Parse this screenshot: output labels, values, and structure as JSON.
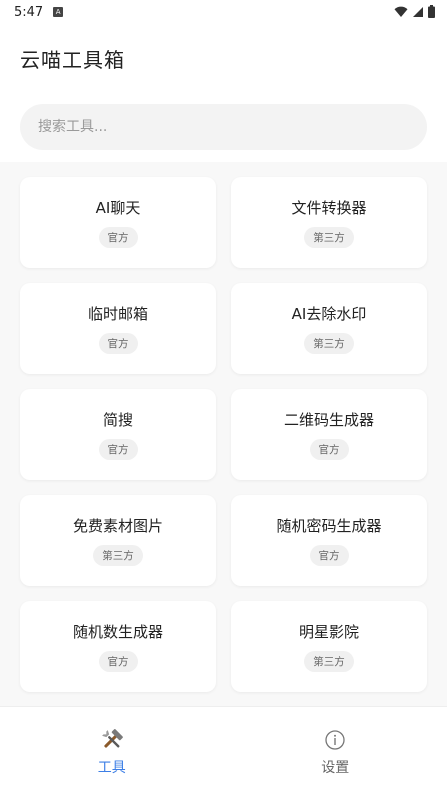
{
  "status_bar": {
    "time": "5:47",
    "notification_badge": "A"
  },
  "app": {
    "title": "云喵工具箱"
  },
  "search": {
    "placeholder": "搜索工具..."
  },
  "tools": [
    {
      "name": "AI聊天",
      "badge": "官方"
    },
    {
      "name": "文件转换器",
      "badge": "第三方"
    },
    {
      "name": "临时邮箱",
      "badge": "官方"
    },
    {
      "name": "AI去除水印",
      "badge": "第三方"
    },
    {
      "name": "简搜",
      "badge": "官方"
    },
    {
      "name": "二维码生成器",
      "badge": "官方"
    },
    {
      "name": "免费素材图片",
      "badge": "第三方"
    },
    {
      "name": "随机密码生成器",
      "badge": "官方"
    },
    {
      "name": "随机数生成器",
      "badge": "官方"
    },
    {
      "name": "明星影院",
      "badge": "第三方"
    }
  ],
  "nav": {
    "tools": {
      "label": "工具",
      "icon": "tools-icon",
      "active": true
    },
    "settings": {
      "label": "设置",
      "icon": "info-icon",
      "active": false
    }
  },
  "colors": {
    "accent": "#3d7fe6",
    "card_bg": "#ffffff",
    "grid_bg": "#f8f8f8",
    "badge_bg": "#f0f0f0"
  }
}
